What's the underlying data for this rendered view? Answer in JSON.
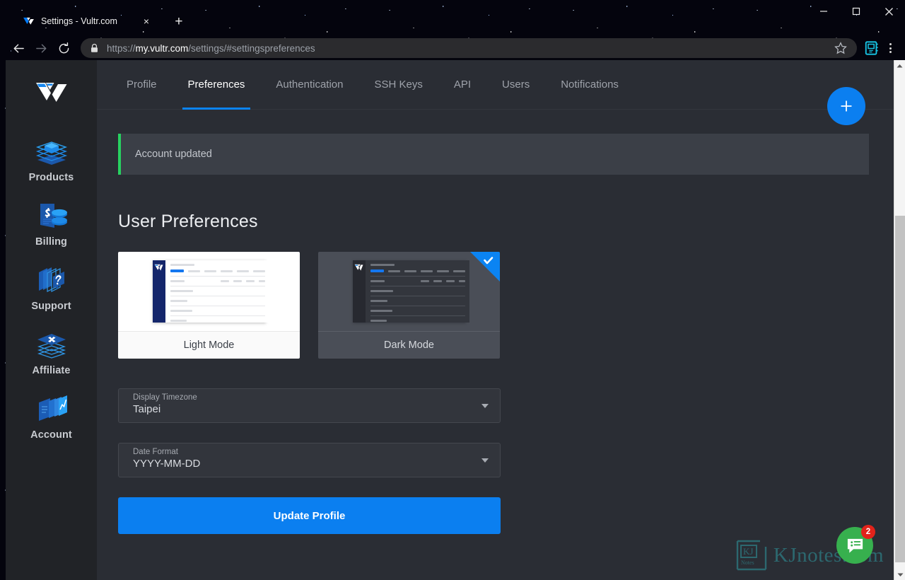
{
  "browser": {
    "tab": {
      "title": "Settings - Vultr.com",
      "favicon_name": "vultr-favicon",
      "close_label": "×",
      "newtab_label": "+"
    },
    "window_controls": {
      "minimize": "–",
      "maximize": "□",
      "close": "✕"
    },
    "toolbar": {
      "back": "←",
      "forward": "→",
      "reload": "↻",
      "lock_icon": "lock-icon",
      "url_full": "https://my.vultr.com/settings/#settingspreferences",
      "url_prefix": "https://",
      "url_host": "my.vultr.com",
      "url_path": "/settings/#settingspreferences",
      "bookmark_icon": "star-icon",
      "extension_icon": "extension-icon",
      "menu_icon": "kebab-menu-icon"
    }
  },
  "sidebar": {
    "logo_name": "vultr-logo",
    "items": [
      {
        "label": "Products",
        "icon": "layers-cube-icon"
      },
      {
        "label": "Billing",
        "icon": "invoice-coins-icon"
      },
      {
        "label": "Support",
        "icon": "question-bubble-icon"
      },
      {
        "label": "Affiliate",
        "icon": "layers-x-icon"
      },
      {
        "label": "Account",
        "icon": "cards-chart-icon"
      }
    ]
  },
  "main": {
    "tabs": [
      {
        "label": "Profile",
        "active": false
      },
      {
        "label": "Preferences",
        "active": true
      },
      {
        "label": "Authentication",
        "active": false
      },
      {
        "label": "SSH Keys",
        "active": false
      },
      {
        "label": "API",
        "active": false
      },
      {
        "label": "Users",
        "active": false
      },
      {
        "label": "Notifications",
        "active": false
      }
    ],
    "fab": {
      "label": "+",
      "icon": "plus-icon"
    },
    "alert": {
      "text": "Account updated",
      "accent_color": "#27d160"
    },
    "page_title": "User Preferences",
    "theme_cards": [
      {
        "label": "Light Mode",
        "selected": false
      },
      {
        "label": "Dark Mode",
        "selected": true
      }
    ],
    "selected_check": "✓",
    "fields": [
      {
        "label": "Display Timezone",
        "value": "Taipei"
      },
      {
        "label": "Date Format",
        "value": "YYYY-MM-DD"
      }
    ],
    "submit_label": "Update Profile"
  },
  "overlay": {
    "chat": {
      "icon": "chat-bubble-icon",
      "badge": "2",
      "color": "#37b04e"
    },
    "watermark": {
      "text": "KJnotes.com",
      "logo_text": "KJ",
      "logo_sub": "Notes",
      "color": "#2e7f86"
    }
  },
  "theme": {
    "accent_blue": "#0b7ff0",
    "page_bg": "#2a2d34",
    "sidebar_bg": "#212327",
    "alert_bg": "#3b3f47"
  }
}
